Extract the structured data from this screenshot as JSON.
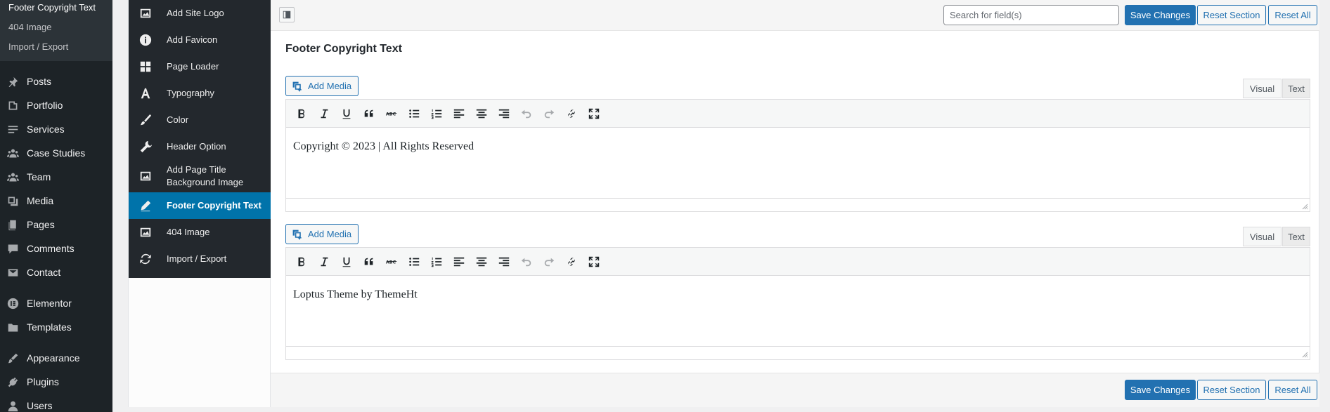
{
  "admin_menu": {
    "submenu": [
      {
        "label": "Footer Copyright Text"
      },
      {
        "label": "404 Image"
      },
      {
        "label": "Import / Export"
      }
    ],
    "items": [
      {
        "label": "Posts",
        "icon": "pin-icon"
      },
      {
        "label": "Portfolio",
        "icon": "portfolio-icon"
      },
      {
        "label": "Services",
        "icon": "list-icon"
      },
      {
        "label": "Case Studies",
        "icon": "group-icon"
      },
      {
        "label": "Team",
        "icon": "group-icon"
      },
      {
        "label": "Media",
        "icon": "media-icon"
      },
      {
        "label": "Pages",
        "icon": "pages-icon"
      },
      {
        "label": "Comments",
        "icon": "comment-icon"
      },
      {
        "label": "Contact",
        "icon": "mail-icon"
      },
      {
        "label": "Elementor",
        "icon": "elementor-icon"
      },
      {
        "label": "Templates",
        "icon": "folder-icon"
      },
      {
        "label": "Appearance",
        "icon": "brush-icon"
      },
      {
        "label": "Plugins",
        "icon": "plug-icon"
      },
      {
        "label": "Users",
        "icon": "user-icon"
      }
    ]
  },
  "redux_sidebar": {
    "items": [
      {
        "label": "Add Site Logo",
        "icon": "image-icon"
      },
      {
        "label": "Add Favicon",
        "icon": "info-icon"
      },
      {
        "label": "Page Loader",
        "icon": "grid-icon"
      },
      {
        "label": "Typography",
        "icon": "typography-icon"
      },
      {
        "label": "Color",
        "icon": "brush-icon"
      },
      {
        "label": "Header Option",
        "icon": "tool-icon"
      },
      {
        "label": "Add Page Title Background Image",
        "icon": "image-icon"
      },
      {
        "label": "Footer Copyright Text",
        "icon": "pencil-icon",
        "active": true
      },
      {
        "label": "404 Image",
        "icon": "image-icon"
      },
      {
        "label": "Import / Export",
        "icon": "refresh-icon"
      }
    ]
  },
  "header": {
    "search_placeholder": "Search for field(s)",
    "save_label": "Save Changes",
    "reset_section_label": "Reset Section",
    "reset_all_label": "Reset All"
  },
  "section": {
    "title": "Footer Copyright Text"
  },
  "editors": [
    {
      "add_media_label": "Add Media",
      "visual_tab": "Visual",
      "text_tab": "Text",
      "content": "Copyright © 2023 | All Rights Reserved"
    },
    {
      "add_media_label": "Add Media",
      "visual_tab": "Visual",
      "text_tab": "Text",
      "content": "Loptus Theme by ThemeHt"
    }
  ],
  "footer": {
    "save_label": "Save Changes",
    "reset_section_label": "Reset Section",
    "reset_all_label": "Reset All"
  },
  "colors": {
    "primary": "#2271b1",
    "active_section": "#0073aa",
    "admin_bg": "#1d2327"
  }
}
